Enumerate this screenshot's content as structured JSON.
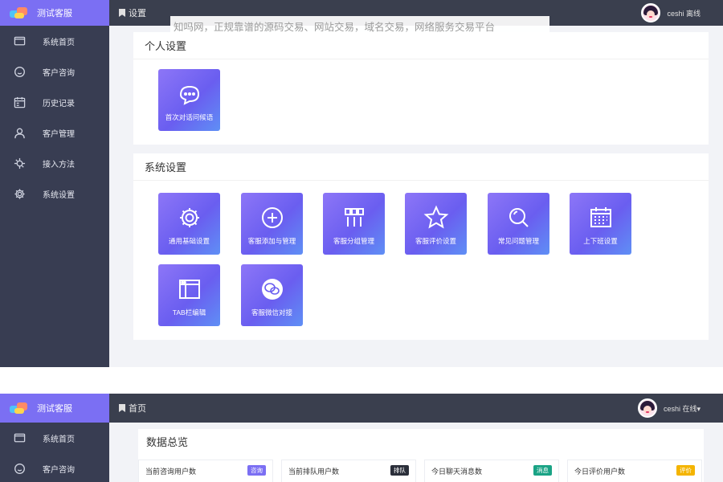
{
  "watermark": "知吗网，正规靠谱的源码交易、网站交易，域名交易，网络服务交易平台",
  "screen1": {
    "brand": "测试客服",
    "breadcrumb": "设置",
    "user": "ceshi 离线",
    "nav": [
      {
        "label": "系统首页",
        "icon": "monitor-icon"
      },
      {
        "label": "客户咨询",
        "icon": "smile-icon"
      },
      {
        "label": "历史记录",
        "icon": "calendar-icon"
      },
      {
        "label": "客户管理",
        "icon": "user-icon"
      },
      {
        "label": "接入方法",
        "icon": "plug-icon"
      },
      {
        "label": "系统设置",
        "icon": "gear-icon"
      }
    ],
    "personal": {
      "title": "个人设置",
      "tiles": [
        {
          "label": "首次对话问候语",
          "icon": "chat-bubble-icon"
        }
      ]
    },
    "system": {
      "title": "系统设置",
      "tiles": [
        {
          "label": "通用基础设置",
          "icon": "gear-icon"
        },
        {
          "label": "客服添加与管理",
          "icon": "plus-circle-icon"
        },
        {
          "label": "客服分组管理",
          "icon": "group-grid-icon"
        },
        {
          "label": "客服评价设置",
          "icon": "star-icon"
        },
        {
          "label": "常见问题管理",
          "icon": "search-icon"
        },
        {
          "label": "上下班设置",
          "icon": "calendar-grid-icon"
        },
        {
          "label": "TAB栏编辑",
          "icon": "window-icon"
        },
        {
          "label": "客服微信对接",
          "icon": "wechat-icon"
        }
      ]
    }
  },
  "screen2": {
    "brand": "测试客服",
    "breadcrumb": "首页",
    "user": "ceshi 在线▾",
    "nav": [
      {
        "label": "系统首页",
        "icon": "monitor-icon"
      },
      {
        "label": "客户咨询",
        "icon": "smile-icon"
      }
    ],
    "overview": {
      "title": "数据总览",
      "stats": [
        {
          "label": "当前咨询用户数",
          "badge": "咨询",
          "color": "#7b6ff3"
        },
        {
          "label": "当前排队用户数",
          "badge": "排队",
          "color": "#2b2f3a"
        },
        {
          "label": "今日聊天消息数",
          "badge": "消息",
          "color": "#1aa385"
        },
        {
          "label": "今日评价用户数",
          "badge": "评价",
          "color": "#f4b400"
        }
      ]
    }
  }
}
